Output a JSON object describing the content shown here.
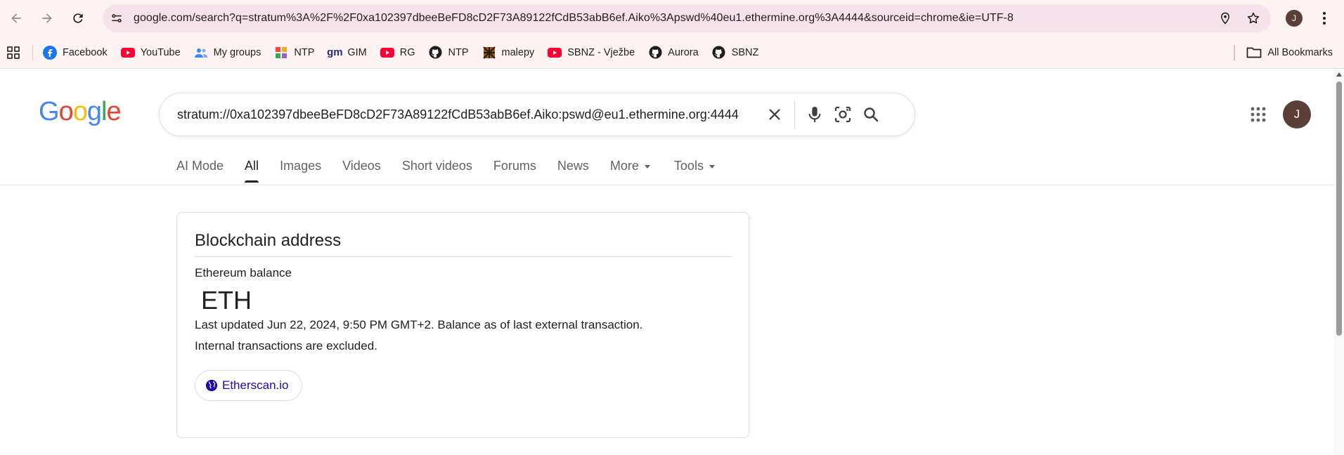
{
  "browser": {
    "url": "google.com/search?q=stratum%3A%2F%2F0xa102397dbeeBeFD8cD2F73A89122fCdB53abB6ef.Aiko%3Apswd%40eu1.ethermine.org%3A4444&sourceid=chrome&ie=UTF-8",
    "profile_initial": "J"
  },
  "bookmarks": {
    "items": [
      {
        "label": "Facebook",
        "icon": "facebook-icon"
      },
      {
        "label": "YouTube",
        "icon": "youtube-icon"
      },
      {
        "label": "My groups",
        "icon": "groups-icon"
      },
      {
        "label": "NTP",
        "icon": "ntp-icon"
      },
      {
        "label": "GIM",
        "icon": "gim-icon"
      },
      {
        "label": "RG",
        "icon": "youtube-icon"
      },
      {
        "label": "NTP",
        "icon": "github-icon"
      },
      {
        "label": "malepy",
        "icon": "malepy-icon"
      },
      {
        "label": "SBNZ - Vježbe",
        "icon": "youtube-icon"
      },
      {
        "label": "Aurora",
        "icon": "github-icon"
      },
      {
        "label": "SBNZ",
        "icon": "github-icon"
      }
    ],
    "all_label": "All Bookmarks"
  },
  "google": {
    "logo_text": "Google",
    "query": "stratum://0xa102397dbeeBeFD8cD2F73A89122fCdB53abB6ef.Aiko:pswd@eu1.ethermine.org:4444",
    "avatar_initial": "J",
    "tabs": [
      {
        "label": "AI Mode"
      },
      {
        "label": "All"
      },
      {
        "label": "Images"
      },
      {
        "label": "Videos"
      },
      {
        "label": "Short videos"
      },
      {
        "label": "Forums"
      },
      {
        "label": "News"
      },
      {
        "label": "More"
      },
      {
        "label": "Tools"
      }
    ],
    "active_tab": "All"
  },
  "card": {
    "title": "Blockchain address",
    "subtitle": "Ethereum balance",
    "currency": "ETH",
    "note_line1": "Last updated Jun 22, 2024, 9:50 PM GMT+2. Balance as of last external transaction.",
    "note_line2": "Internal transactions are excluded.",
    "link_label": "Etherscan.io"
  },
  "colors": {
    "chrome_bg": "#fdf3f3",
    "omnibox_bg": "#f6e2ea",
    "google_blue": "#4285f4",
    "google_red": "#ea4335",
    "google_yellow": "#fbbc05",
    "google_green": "#34a853",
    "link": "#1a0dab"
  }
}
